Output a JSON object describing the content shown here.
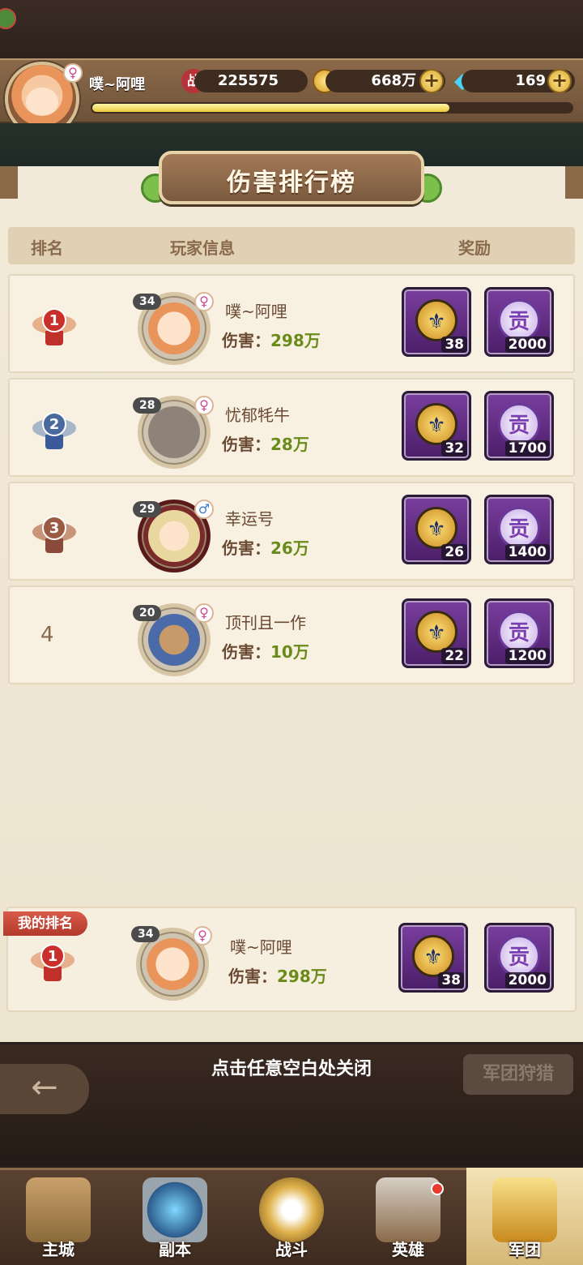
{
  "player": {
    "name": "噗~阿哩",
    "level": "34",
    "gender_symbol": "♀",
    "power_icon": "战",
    "power": "225575",
    "gold": "668万",
    "diamonds": "169",
    "exp_fraction": 0.74
  },
  "title": "伤害排行榜",
  "columns": {
    "rank": "排名",
    "info": "玩家信息",
    "reward": "奖励"
  },
  "damage_label": "伤害：",
  "rows": [
    {
      "rank": "1",
      "name": "噗~阿哩",
      "level": "34",
      "gender": "♀",
      "damage": "298万",
      "reward_a": "38",
      "reward_b": "2000"
    },
    {
      "rank": "2",
      "name": "忧郁牦牛",
      "level": "28",
      "gender": "♀",
      "damage": "28万",
      "reward_a": "32",
      "reward_b": "1700"
    },
    {
      "rank": "3",
      "name": "幸运号",
      "level": "29",
      "gender": "♂",
      "damage": "26万",
      "reward_a": "26",
      "reward_b": "1400"
    },
    {
      "rank": "4",
      "name": "顶刊且一作",
      "level": "20",
      "gender": "♀",
      "damage": "10万",
      "reward_a": "22",
      "reward_b": "1200"
    }
  ],
  "my_rank": {
    "tag": "我的排名",
    "rank": "1",
    "name": "噗~阿哩",
    "level": "34",
    "gender": "♀",
    "damage": "298万",
    "reward_a": "38",
    "reward_b": "2000"
  },
  "reward_icons": {
    "a": "trident-coin-icon",
    "b": "contribution-icon",
    "b_glyph": "贡"
  },
  "close_hint": "点击任意空白处关闭",
  "back_icon": "←",
  "hunt_button": "军团狩猎",
  "tabs": [
    {
      "label": "主城",
      "icon": "castle-icon"
    },
    {
      "label": "副本",
      "icon": "portal-icon"
    },
    {
      "label": "战斗",
      "icon": "sword-icon"
    },
    {
      "label": "英雄",
      "icon": "helmet-icon"
    },
    {
      "label": "军团",
      "icon": "banner-icon"
    }
  ]
}
